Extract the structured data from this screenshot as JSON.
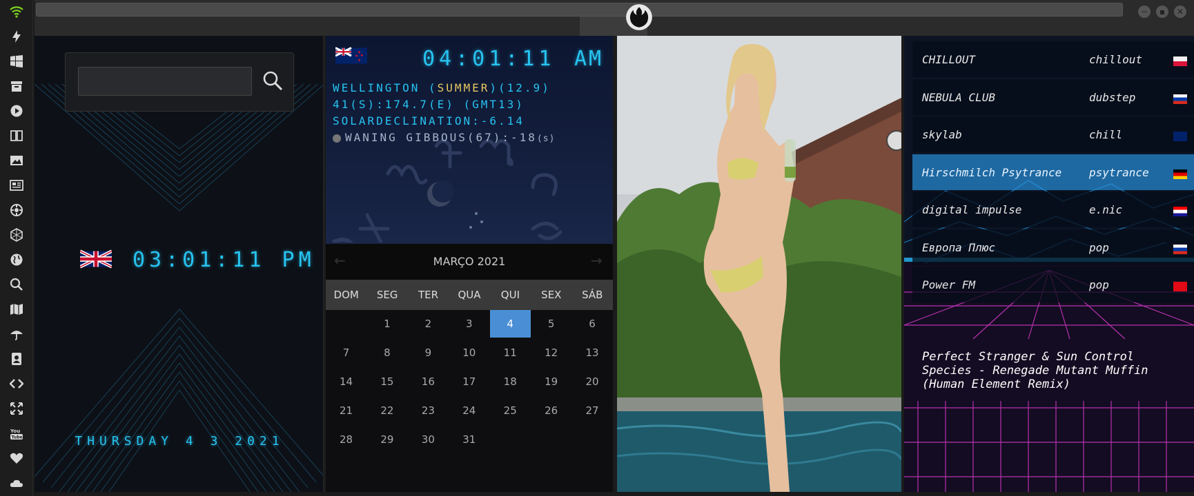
{
  "sidebar": {
    "icons": [
      "wifi-icon",
      "lightning-icon",
      "windows-icon",
      "archive-icon",
      "play-icon",
      "book-icon",
      "image-icon",
      "news-icon",
      "settings-icon",
      "hexagon-icon",
      "globe-icon",
      "search-icon",
      "map-icon",
      "umbrella-icon",
      "contact-icon",
      "code-icon",
      "fullscreen-icon",
      "youtube-icon",
      "heart-icon",
      "cloud-icon"
    ]
  },
  "window": {
    "logo": "rebel-alliance-logo"
  },
  "clock_uk": {
    "time": "03:01:11 PM",
    "date": "THURSDAY 4 3 2021",
    "flag": "uk-flag"
  },
  "search": {
    "value": "",
    "placeholder": ""
  },
  "clock_nz": {
    "flag": "nz-flag",
    "time": "04:01:11",
    "ampm": "AM",
    "line1_a": "WELLINGTON (",
    "line1_season": "SUMMER",
    "line1_b": ")(12.9)",
    "line2": "41(S):174.7(E) (GMT13)",
    "line3": "SOLARDECLINATION:-6.14",
    "line4": "WANING GIBBOUS(67):-18",
    "line4_unit": "(s)"
  },
  "calendar": {
    "month_label": "MARÇO 2021",
    "days": [
      "DOM",
      "SEG",
      "TER",
      "QUA",
      "QUI",
      "SEX",
      "SÁB"
    ],
    "weeks": [
      [
        "",
        "1",
        "2",
        "3",
        "4",
        "5",
        "6"
      ],
      [
        "7",
        "8",
        "9",
        "10",
        "11",
        "12",
        "13"
      ],
      [
        "14",
        "15",
        "16",
        "17",
        "18",
        "19",
        "20"
      ],
      [
        "21",
        "22",
        "23",
        "24",
        "25",
        "26",
        "27"
      ],
      [
        "28",
        "29",
        "30",
        "31",
        "",
        "",
        ""
      ]
    ],
    "today": "4"
  },
  "radio": {
    "stations": [
      {
        "name": "CHILLOUT",
        "genre": "chillout",
        "flag": "poland-flag",
        "active": false
      },
      {
        "name": "NEBULA CLUB",
        "genre": "dubstep",
        "flag": "russia-flag",
        "active": false
      },
      {
        "name": "skylab",
        "genre": "chill",
        "flag": "uk-flag",
        "active": false
      },
      {
        "name": "Hirschmilch Psytrance",
        "genre": "psytrance",
        "flag": "germany-flag",
        "active": true
      },
      {
        "name": "digital impulse",
        "genre": "e.nic",
        "flag": "croatia-flag",
        "active": false
      },
      {
        "name": "Европа Плюс",
        "genre": "pop",
        "flag": "russia-flag",
        "active": false
      },
      {
        "name": "Power FM",
        "genre": "pop",
        "flag": "turkey-flag",
        "active": false
      }
    ],
    "now_playing_1": "Perfect Stranger & Sun Control",
    "now_playing_2": "Species - Renegade Mutant Muffin",
    "now_playing_3": "(Human Element Remix)"
  }
}
